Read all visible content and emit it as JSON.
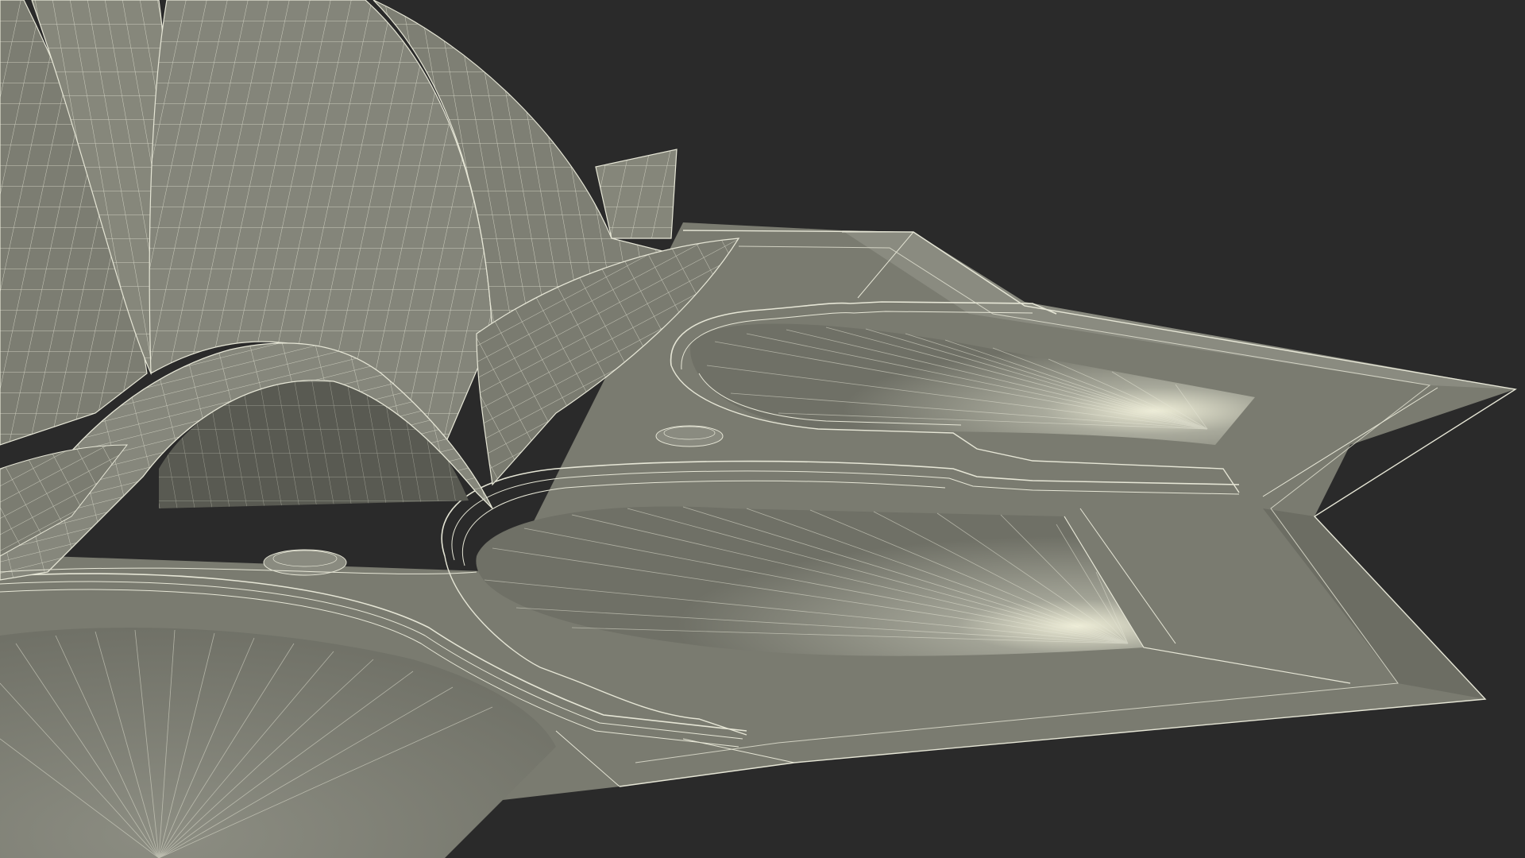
{
  "scene": {
    "subject": "lotus-temple-wireframe-model",
    "colors": {
      "background": "#2a2a2a",
      "surface": "#7e7f74",
      "surface_light": "#8c8d82",
      "surface_dark": "#5f6057",
      "pool": "#6f7066",
      "pool_glow": "#efeed8",
      "wire": "#e6e6d6"
    }
  }
}
